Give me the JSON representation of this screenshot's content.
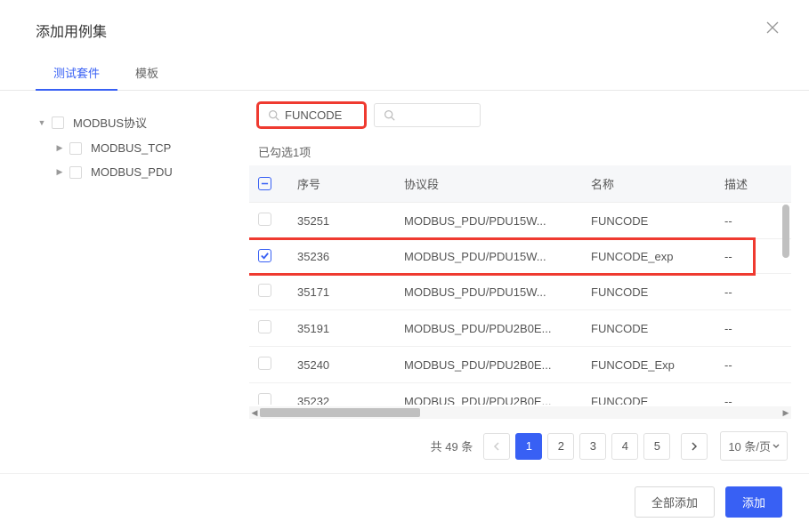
{
  "modal": {
    "title": "添加用例集"
  },
  "tabs": {
    "suite": "测试套件",
    "template": "模板"
  },
  "tree": {
    "root": "MODBUS协议",
    "children": {
      "tcp": "MODBUS_TCP",
      "pdu": "MODBUS_PDU"
    }
  },
  "search": {
    "value": "FUNCODE",
    "placeholder2": ""
  },
  "selected_text": "已勾选1项",
  "columns": {
    "seq": "序号",
    "proto": "协议段",
    "name": "名称",
    "desc": "描述"
  },
  "rows": [
    {
      "seq": "35251",
      "proto": "MODBUS_PDU/PDU15W...",
      "name": "FUNCODE",
      "desc": "--",
      "checked": false
    },
    {
      "seq": "35236",
      "proto": "MODBUS_PDU/PDU15W...",
      "name": "FUNCODE_exp",
      "desc": "--",
      "checked": true
    },
    {
      "seq": "35171",
      "proto": "MODBUS_PDU/PDU15W...",
      "name": "FUNCODE",
      "desc": "--",
      "checked": false
    },
    {
      "seq": "35191",
      "proto": "MODBUS_PDU/PDU2B0E...",
      "name": "FUNCODE",
      "desc": "--",
      "checked": false
    },
    {
      "seq": "35240",
      "proto": "MODBUS_PDU/PDU2B0E...",
      "name": "FUNCODE_Exp",
      "desc": "--",
      "checked": false
    },
    {
      "seq": "35232",
      "proto": "MODBUS_PDU/PDU2B0E...",
      "name": "FUNCODE",
      "desc": "--",
      "checked": false
    }
  ],
  "pagination": {
    "total_label": "共 49 条",
    "pages": [
      "1",
      "2",
      "3",
      "4",
      "5"
    ],
    "page_size": "10 条/页"
  },
  "buttons": {
    "add_all": "全部添加",
    "add": "添加"
  }
}
